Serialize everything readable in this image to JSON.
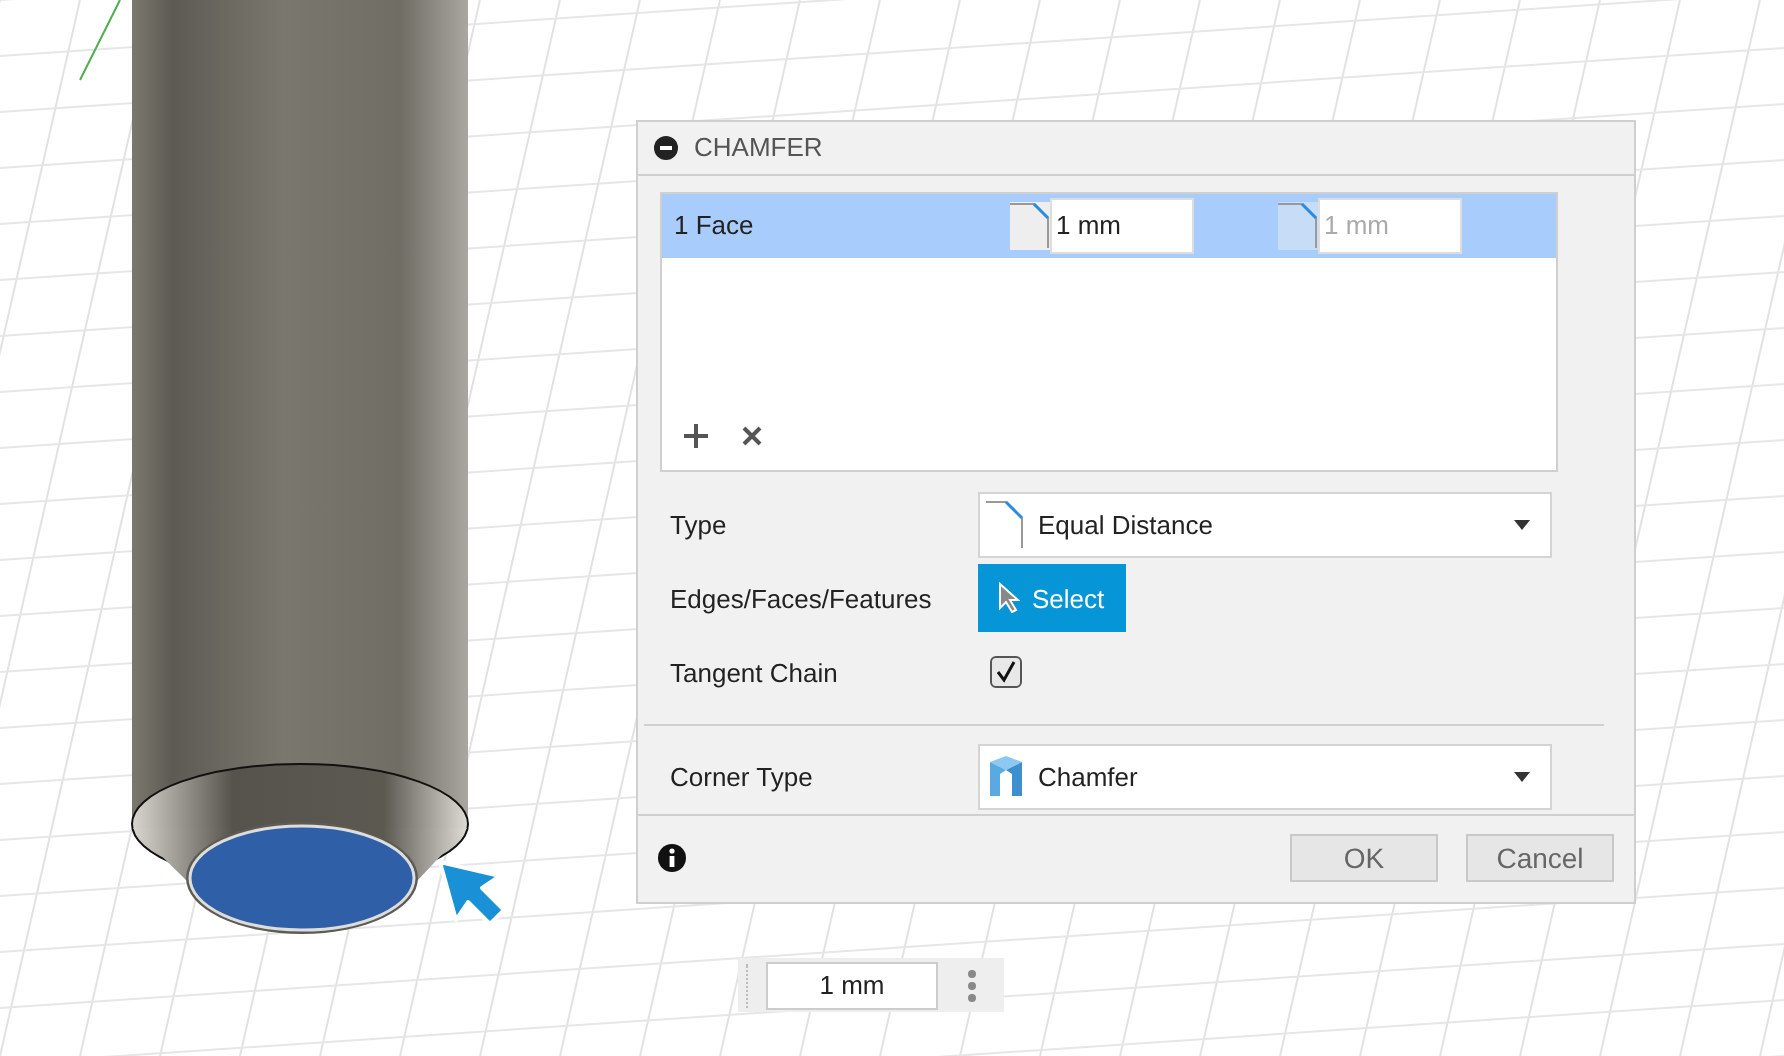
{
  "dialog": {
    "title": "CHAMFER",
    "collapsed": false,
    "selection_rows": [
      {
        "label": "1 Face",
        "selected": true,
        "distance": {
          "value": "1 mm",
          "disabled": false
        },
        "distance_2": {
          "value": "1 mm",
          "disabled": true
        }
      }
    ],
    "fields": [
      {
        "kind": "dropdown",
        "label": "Type",
        "value": "Equal Distance"
      },
      {
        "kind": "select",
        "label": "Edges/Faces/Features",
        "button": "Select"
      },
      {
        "kind": "checkbox",
        "label": "Tangent Chain",
        "checked": true
      },
      {
        "kind": "divider"
      },
      {
        "kind": "dropdown",
        "label": "Corner Type",
        "value": "Chamfer"
      }
    ],
    "buttons": [
      "OK",
      "Cancel"
    ]
  },
  "distance_input": {
    "value": "1 mm"
  }
}
